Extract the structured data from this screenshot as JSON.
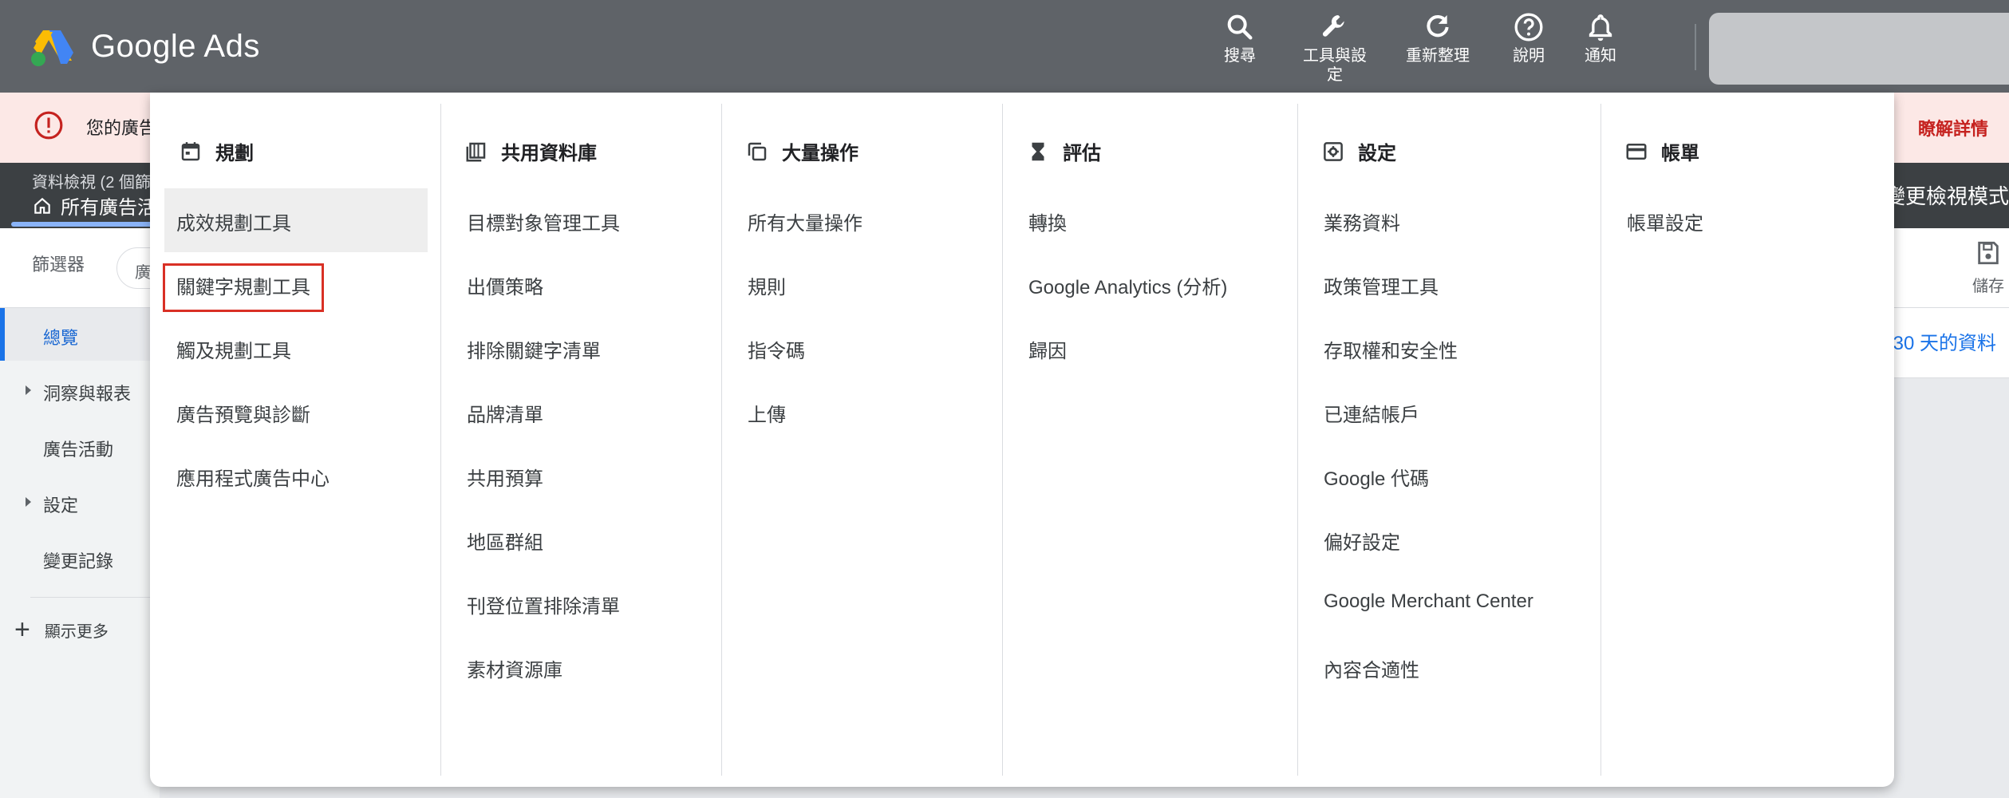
{
  "topbar": {
    "brand": "Google Ads",
    "tools": [
      {
        "label": "搜尋",
        "icon": "search-icon"
      },
      {
        "label": "工具與設定",
        "icon": "wrench-icon"
      },
      {
        "label": "重新整理",
        "icon": "refresh-icon"
      },
      {
        "label": "說明",
        "icon": "help-icon"
      },
      {
        "label": "通知",
        "icon": "bell-icon"
      }
    ]
  },
  "alert": {
    "text": "您的廣告",
    "link": "瞭解詳情"
  },
  "subbar": {
    "small": "資料檢視 (2 個篩",
    "main": "所有廣告活",
    "right": "變更檢視模式"
  },
  "filterbar": {
    "label": "篩選器",
    "chip": "廣",
    "save": "儲存",
    "date": "30 天的資料"
  },
  "leftnav": {
    "items": [
      {
        "label": "總覽"
      },
      {
        "label": "洞察與報表"
      },
      {
        "label": "廣告活動"
      },
      {
        "label": "設定"
      },
      {
        "label": "變更記錄"
      }
    ],
    "more": "顯示更多"
  },
  "menu": {
    "columns": [
      {
        "heading": "規劃",
        "icon": "calendar-icon",
        "items": [
          "成效規劃工具",
          "關鍵字規劃工具",
          "觸及規劃工具",
          "廣告預覽與診斷",
          "應用程式廣告中心"
        ]
      },
      {
        "heading": "共用資料庫",
        "icon": "library-icon",
        "items": [
          "目標對象管理工具",
          "出價策略",
          "排除關鍵字清單",
          "品牌清單",
          "共用預算",
          "地區群組",
          "刊登位置排除清單",
          "素材資源庫"
        ]
      },
      {
        "heading": "大量操作",
        "icon": "copy-icon",
        "items": [
          "所有大量操作",
          "規則",
          "指令碼",
          "上傳"
        ]
      },
      {
        "heading": "評估",
        "icon": "hourglass-icon",
        "items": [
          "轉換",
          "Google Analytics (分析)",
          "歸因"
        ]
      },
      {
        "heading": "設定",
        "icon": "settings-icon",
        "items": [
          "業務資料",
          "政策管理工具",
          "存取權和安全性",
          "已連結帳戶",
          "Google 代碼",
          "偏好設定",
          "Google Merchant Center",
          "內容合適性"
        ]
      },
      {
        "heading": "帳單",
        "icon": "credit-card-icon",
        "items": [
          "帳單設定"
        ]
      }
    ]
  }
}
